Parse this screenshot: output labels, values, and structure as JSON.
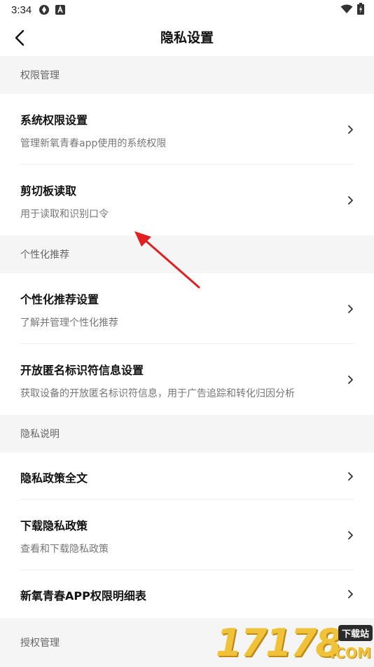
{
  "status_bar": {
    "time": "3:34",
    "icons": [
      "sync-icon",
      "notification-a-icon",
      "wifi-icon",
      "battery-charging-icon"
    ]
  },
  "header": {
    "title": "隐私设置",
    "back_icon": "chevron-left-icon"
  },
  "sections": [
    {
      "title": "权限管理",
      "items": [
        {
          "title": "系统权限设置",
          "subtitle": "管理新氧青春app使用的系统权限"
        },
        {
          "title": "剪切板读取",
          "subtitle": "用于读取和识别口令"
        }
      ]
    },
    {
      "title": "个性化推荐",
      "items": [
        {
          "title": "个性化推荐设置",
          "subtitle": "了解并管理个性化推荐"
        },
        {
          "title": "开放匿名标识符信息设置",
          "subtitle": "获取设备的开放匿名标识符信息，用于广告追踪和转化归因分析"
        }
      ]
    },
    {
      "title": "隐私说明",
      "items": [
        {
          "title": "隐私政策全文"
        },
        {
          "title": "下载隐私政策",
          "subtitle": "查看和下载隐私政策"
        },
        {
          "title": "新氧青春APP权限明细表"
        }
      ]
    },
    {
      "title": "授权管理",
      "items": []
    }
  ],
  "annotation": {
    "arrow_color": "#e02020"
  },
  "watermark": {
    "number": "17178",
    "tag": "下载站",
    "suffix": ".COM",
    "color": "#f0c23a"
  }
}
